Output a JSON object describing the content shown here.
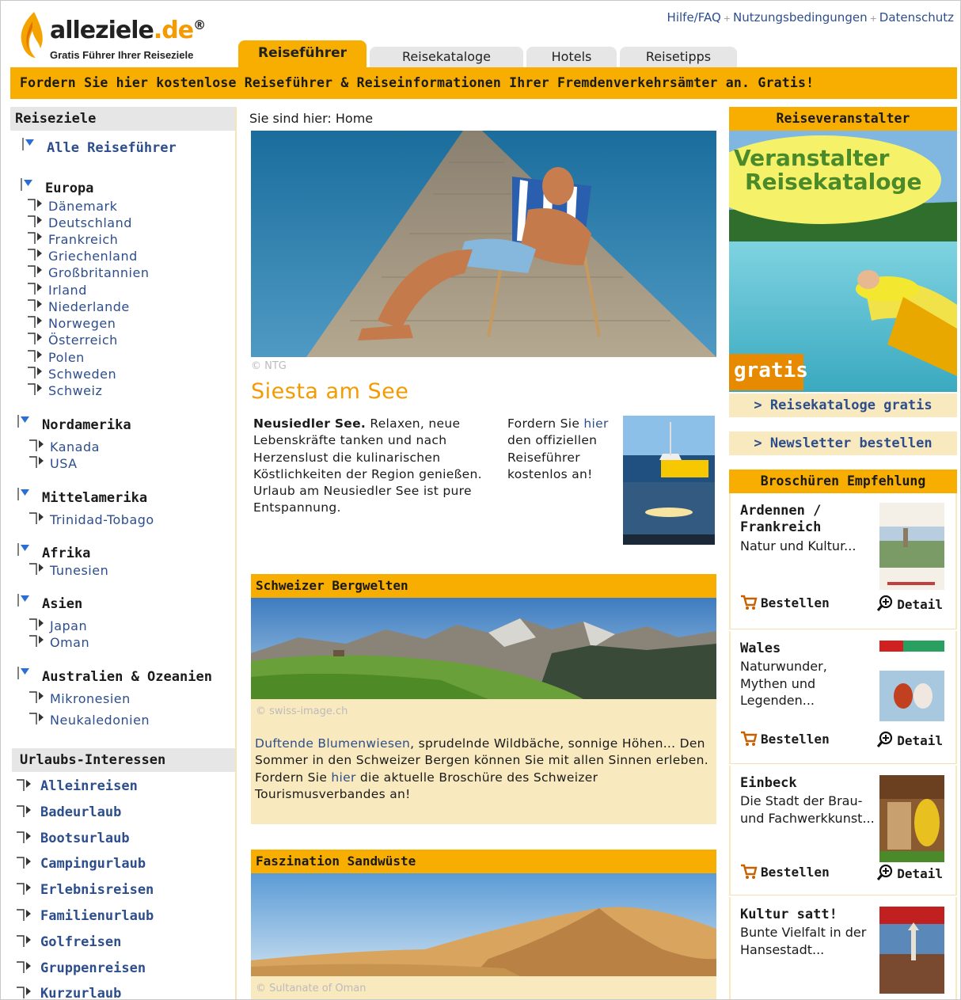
{
  "header": {
    "brand_main": "alleziele",
    "brand_tld": ".de",
    "brand_reg": "®",
    "tagline": "Gratis Führer Ihrer Reiseziele",
    "toplinks": [
      "Hilfe/FAQ",
      "Nutzungsbedingungen",
      "Datenschutz"
    ],
    "tabs": [
      "Reiseführer",
      "Reisekataloge",
      "Hotels",
      "Reisetipps"
    ],
    "banner": "Fordern Sie hier kostenlose Reiseführer & Reiseinformationen Ihrer Fremdenverkehrsämter an. Gratis!"
  },
  "sidebar": {
    "reiseziele_heading": "Reiseziele",
    "all_guides": "Alle Reiseführer",
    "regions": [
      {
        "name": "Europa",
        "items": [
          "Dänemark",
          "Deutschland",
          "Frankreich",
          "Griechenland",
          "Großbritannien",
          "Irland",
          "Niederlande",
          "Norwegen",
          "Österreich",
          "Polen",
          "Schweden",
          "Schweiz"
        ]
      },
      {
        "name": "Nordamerika",
        "items": [
          "Kanada",
          "USA"
        ]
      },
      {
        "name": "Mittelamerika",
        "items": [
          "Trinidad-Tobago"
        ]
      },
      {
        "name": "Afrika",
        "items": [
          "Tunesien"
        ]
      },
      {
        "name": "Asien",
        "items": [
          "Japan",
          "Oman"
        ]
      },
      {
        "name": "Australien & Ozeanien",
        "items": [
          "Mikronesien",
          "Neukaledonien"
        ]
      }
    ],
    "interests_heading": "Urlaubs-Interessen",
    "interests": [
      "Alleinreisen",
      "Badeurlaub",
      "Bootsurlaub",
      "Campingurlaub",
      "Erlebnisreisen",
      "Familienurlaub",
      "Golfreisen",
      "Gruppenreisen",
      "Kurzurlaub"
    ]
  },
  "main": {
    "breadcrumb": "Sie sind hier: Home",
    "hero_credit": "© NTG",
    "feature_title": "Siesta am See",
    "feature_lead": "Neusiedler See.",
    "feature_text": " Relaxen, neue Lebenskräfte tanken und nach Herzenslust die kulinarischen Köstlichkeiten der Region genießen. Urlaub am Neusiedler See ist pure Entspannung.",
    "order_pre": "Fordern Sie ",
    "order_link": "hier",
    "order_post": " den offiziellen Reiseführer kostenlos an!",
    "sections": [
      {
        "title": "Schweizer Bergwelten",
        "credit": "© swiss-image.ch",
        "link_text": "Duftende Blumenwiesen",
        "text_a": ", sprudelnde Wildbäche, sonnige Höhen... Den Sommer in den Schweizer Bergen können Sie mit allen Sinnen erleben. Fordern Sie ",
        "link2": "hier",
        "text_b": " die aktuelle Broschüre des Schweizer Tourismusverbandes an!"
      },
      {
        "title": "Faszination Sandwüste",
        "credit": "© Sultanate of Oman"
      }
    ]
  },
  "right": {
    "operators_heading": "Reiseveranstalter",
    "ad_line1": "Veranstalter",
    "ad_line2": "Reisekataloge",
    "ad_badge": "gratis",
    "catalogs_link": "> Reisekataloge gratis",
    "newsletter_link": "> Newsletter bestellen",
    "brochures_heading": "Broschüren Empfehlung",
    "order_label": "Bestellen",
    "detail_label": "Detail",
    "brochures": [
      {
        "title": "Ardennen / Frankreich",
        "desc": "Natur und Kultur..."
      },
      {
        "title": "Wales",
        "desc": "Naturwunder, Mythen und Legenden..."
      },
      {
        "title": "Einbeck",
        "desc": "Die Stadt der Brau- und Fachwerkkunst..."
      },
      {
        "title": "Kultur satt!",
        "desc": "Bunte Vielfalt in der Hansestadt..."
      }
    ]
  },
  "colors": {
    "accent": "#f7ae00",
    "link": "#2d4e8c",
    "section_bg": "#f9e9be",
    "title_orange": "#f59a00"
  }
}
